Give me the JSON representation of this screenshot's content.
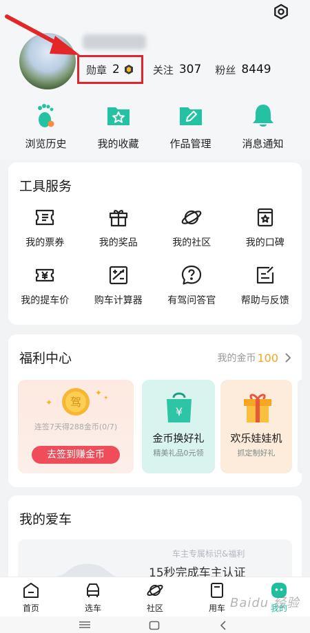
{
  "profile": {
    "badge_label": "勋章",
    "badge_count": "2",
    "follow_label": "关注",
    "follow_count": "307",
    "fans_label": "粉丝",
    "fans_count": "8449"
  },
  "quick_actions": [
    {
      "label": "浏览历史",
      "icon": "footprint-icon"
    },
    {
      "label": "我的收藏",
      "icon": "star-folder-icon"
    },
    {
      "label": "作品管理",
      "icon": "edit-folder-icon"
    },
    {
      "label": "消息通知",
      "icon": "bell-icon"
    }
  ],
  "tools": {
    "title": "工具服务",
    "items": [
      {
        "label": "我的票券",
        "icon": "ticket-icon"
      },
      {
        "label": "我的奖品",
        "icon": "gift-icon"
      },
      {
        "label": "我的社区",
        "icon": "planet-icon"
      },
      {
        "label": "我的口碑",
        "icon": "review-icon"
      },
      {
        "label": "我的提车价",
        "icon": "price-ticket-icon"
      },
      {
        "label": "购车计算器",
        "icon": "calculator-icon"
      },
      {
        "label": "有驾问答官",
        "icon": "question-bubble-icon"
      },
      {
        "label": "帮助与反馈",
        "icon": "feedback-icon"
      }
    ]
  },
  "welfare": {
    "title": "福利中心",
    "coin_label": "我的金币",
    "coin_value": "100",
    "coin_glyph": "驾",
    "signin_note": "连签7天得288金币(0/7)",
    "signin_button": "去签到赚金币",
    "promos": [
      {
        "title": "金币换好礼",
        "subtitle": "精美礼品0元领",
        "icon": "gift-bag-icon"
      },
      {
        "title": "欢乐娃娃机",
        "subtitle": "抓定制好礼",
        "icon": "gift-box-icon"
      }
    ]
  },
  "my_car": {
    "title": "我的爱车",
    "note": "车主专属标识&福利",
    "cta": "15秒完成车主认证"
  },
  "bottom_nav": [
    {
      "label": "首页",
      "icon": "home-icon"
    },
    {
      "label": "选车",
      "icon": "car-select-icon"
    },
    {
      "label": "社区",
      "icon": "planet-icon"
    },
    {
      "label": "用车",
      "icon": "car-use-icon"
    },
    {
      "label": "我的",
      "icon": "profile-face-icon"
    }
  ],
  "watermark": "Baidu 经验",
  "colors": {
    "accent": "#1fbf9e",
    "highlight_box": "#e0242b",
    "coin": "#f5a623",
    "button": "#f04d5a"
  }
}
